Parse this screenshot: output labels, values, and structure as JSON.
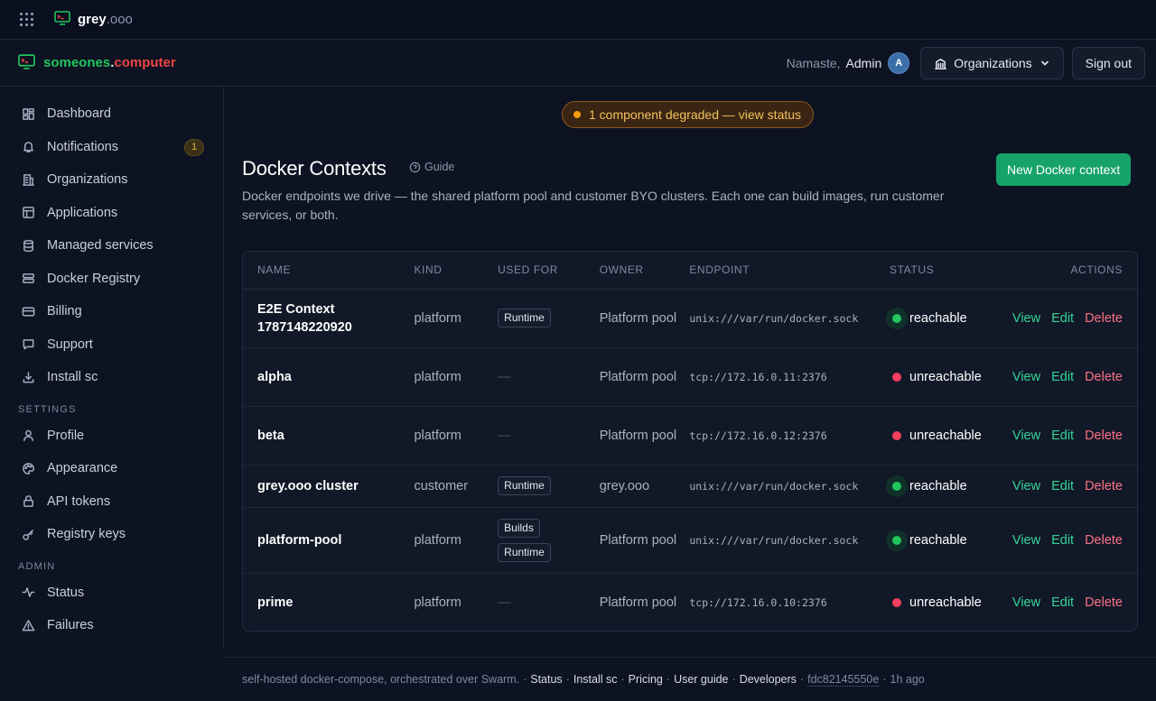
{
  "topbar": {
    "brand_main": "grey",
    "brand_suffix": ".ooo"
  },
  "header": {
    "brand_part1": "someones",
    "brand_part2": ".",
    "brand_part3": "computer",
    "greeting": "Namaste,",
    "user_name": "Admin",
    "avatar_initial": "A",
    "org_button": "Organizations",
    "signout_button": "Sign out"
  },
  "sidebar": {
    "items": [
      {
        "label": "Dashboard",
        "icon": "dashboard-icon"
      },
      {
        "label": "Notifications",
        "icon": "bell-icon",
        "badge": "1"
      },
      {
        "label": "Organizations",
        "icon": "building-icon"
      },
      {
        "label": "Applications",
        "icon": "layout-icon"
      },
      {
        "label": "Managed services",
        "icon": "database-icon"
      },
      {
        "label": "Docker Registry",
        "icon": "server-icon"
      },
      {
        "label": "Billing",
        "icon": "credit-card-icon"
      },
      {
        "label": "Support",
        "icon": "chat-icon"
      },
      {
        "label": "Install sc",
        "icon": "download-icon"
      }
    ],
    "settings_heading": "SETTINGS",
    "settings_items": [
      {
        "label": "Profile",
        "icon": "user-icon"
      },
      {
        "label": "Appearance",
        "icon": "palette-icon"
      },
      {
        "label": "API tokens",
        "icon": "lock-icon"
      },
      {
        "label": "Registry keys",
        "icon": "key-icon"
      }
    ],
    "admin_heading": "ADMIN",
    "admin_items": [
      {
        "label": "Status",
        "icon": "activity-icon"
      },
      {
        "label": "Failures",
        "icon": "warning-icon"
      }
    ]
  },
  "banner": {
    "text": "1 component degraded — view status"
  },
  "page": {
    "title": "Docker Contexts",
    "guide": "Guide",
    "description": "Docker endpoints we drive — the shared platform pool and customer BYO clusters. Each one can build images, run customer services, or both.",
    "new_button": "New Docker context"
  },
  "table": {
    "headers": [
      "NAME",
      "KIND",
      "USED FOR",
      "OWNER",
      "ENDPOINT",
      "STATUS",
      "ACTIONS"
    ],
    "actions": {
      "view": "View",
      "edit": "Edit",
      "delete": "Delete"
    },
    "empty_dash": "—",
    "rows": [
      {
        "name": "E2E Context 1787148220920",
        "kind": "platform",
        "used_for": [
          "Runtime"
        ],
        "owner": "Platform pool",
        "endpoint": "unix:///var/run/docker.sock",
        "status": "reachable"
      },
      {
        "name": "alpha",
        "kind": "platform",
        "used_for": [],
        "owner": "Platform pool",
        "endpoint": "tcp://172.16.0.11:2376",
        "status": "unreachable"
      },
      {
        "name": "beta",
        "kind": "platform",
        "used_for": [],
        "owner": "Platform pool",
        "endpoint": "tcp://172.16.0.12:2376",
        "status": "unreachable"
      },
      {
        "name": "grey.ooo cluster",
        "kind": "customer",
        "used_for": [
          "Runtime"
        ],
        "owner": "grey.ooo",
        "endpoint": "unix:///var/run/docker.sock",
        "status": "reachable"
      },
      {
        "name": "platform-pool",
        "kind": "platform",
        "used_for": [
          "Builds",
          "Runtime"
        ],
        "owner": "Platform pool",
        "endpoint": "unix:///var/run/docker.sock",
        "status": "reachable"
      },
      {
        "name": "prime",
        "kind": "platform",
        "used_for": [],
        "owner": "Platform pool",
        "endpoint": "tcp://172.16.0.10:2376",
        "status": "unreachable"
      }
    ]
  },
  "footer": {
    "text": "self-hosted docker-compose, orchestrated over Swarm.",
    "sep": "·",
    "links": [
      "Status",
      "Install sc",
      "Pricing",
      "User guide",
      "Developers"
    ],
    "hash": "fdc82145550e",
    "age": "1h ago"
  },
  "colors": {
    "accent": "#16a36a",
    "brand_green": "#22c55e",
    "brand_red": "#ef4444",
    "ok": "#22c55e",
    "bad": "#f43f5e",
    "warn": "#f59e0b"
  }
}
